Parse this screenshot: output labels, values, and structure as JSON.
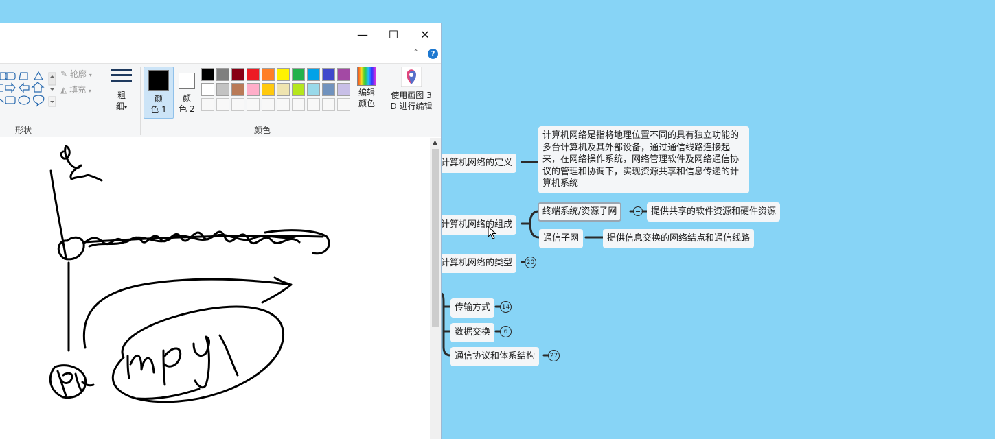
{
  "mindmap": {
    "definition_label": "计算机网络的定义",
    "definition_text": "计算机网络是指将地理位置不同的具有独立功能的多台计算机及其外部设备，通过通信线路连接起来，在网络操作系统，网络管理软件及网络通信协议的管理和协调下，实现资源共享和信息传递的计算机系统",
    "composition_label": "计算机网络的组成",
    "terminal_label": "终端系统/资源子网",
    "terminal_desc": "提供共享的软件资源和硬件资源",
    "comm_subnet_label": "通信子网",
    "comm_subnet_desc": "提供信息交换的网络结点和通信线路",
    "types_label": "计算机网络的类型",
    "types_count": "20",
    "transmission_label": "传输方式",
    "transmission_count": "14",
    "data_exchange_label": "数据交换",
    "data_exchange_count": "6",
    "protocol_label": "通信协议和体系结构",
    "protocol_count": "27"
  },
  "paint": {
    "window_controls": {
      "minimize": "—",
      "maximize": "☐",
      "close": "✕"
    },
    "help": "?",
    "outline_label": "轮廓",
    "fill_label": "填充",
    "shapes_group_label": "形状",
    "size_label_1": "粗",
    "size_label_2": "细",
    "color1_label_1": "颜",
    "color1_label_2": "色 1",
    "color2_label_1": "颜",
    "color2_label_2": "色 2",
    "edit_colors_1": "编辑",
    "edit_colors_2": "颜色",
    "paint3d_1": "使用画图 3",
    "paint3d_2": "D 进行编辑",
    "colors_group_label": "颜色",
    "color1_value": "#000000",
    "color2_value": "#ffffff",
    "palette_row1": [
      "#000000",
      "#7f7f7f",
      "#880015",
      "#ed1c24",
      "#ff7f27",
      "#fff200",
      "#22b14c",
      "#00a2e8",
      "#3f48cc",
      "#a349a4"
    ],
    "palette_row2": [
      "#ffffff",
      "#c3c3c3",
      "#b97a57",
      "#ffaec9",
      "#ffc90e",
      "#efe4b0",
      "#b5e61d",
      "#99d9ea",
      "#7092be",
      "#c8bfe7"
    ]
  },
  "colors": {
    "desktop_bg": "#87d4f6",
    "node_bg": "#f4f6f8",
    "line_color": "#2b2b2b"
  }
}
